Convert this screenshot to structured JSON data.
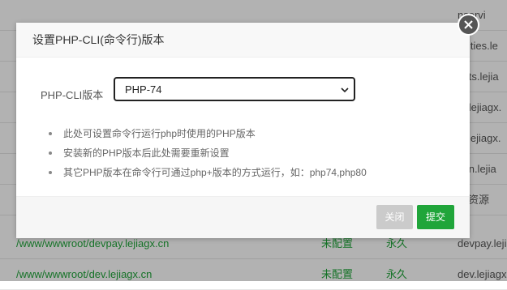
{
  "background_table": {
    "rows": [
      {
        "path": "",
        "status": "",
        "expire": "",
        "remark": "nservi"
      },
      {
        "path": "",
        "status": "",
        "expire": "",
        "remark": "tivities.le"
      },
      {
        "path": "",
        "status": "",
        "expire": "",
        "remark": "sets.lejia"
      },
      {
        "path": "",
        "status": "",
        "expire": "",
        "remark": "st.lejiagx."
      },
      {
        "path": "",
        "status": "",
        "expire": "",
        "remark": "vi.lejiagx."
      },
      {
        "path": "",
        "status": "",
        "expire": "",
        "remark": "min.lejia"
      },
      {
        "path": "",
        "status": "",
        "expire": "",
        "remark": "片资源"
      },
      {
        "path": "/www/wwwroot/devpay.lejiagx.cn",
        "status": "未配置",
        "expire": "永久",
        "remark": "devpay.leji"
      },
      {
        "path": "/www/wwwroot/dev.lejiagx.cn",
        "status": "未配置",
        "expire": "永久",
        "remark": "dev.lejiagx"
      }
    ]
  },
  "dialog": {
    "title": "设置PHP-CLI(命令行)版本",
    "field_label": "PHP-CLI版本",
    "select_value": "PHP-74",
    "tips": [
      "此处可设置命令行运行php时使用的PHP版本",
      "安装新的PHP版本后此处需要重新设置",
      "其它PHP版本在命令行可通过php+版本的方式运行，如：php74,php80"
    ],
    "close_label": "关闭",
    "submit_label": "提交"
  },
  "colors": {
    "accent": "#20a53a",
    "disabled_button": "#cbcbcb",
    "overlay": "rgba(0,0,0,0.3)"
  },
  "icons": {
    "dialog_close": "close-icon",
    "select_arrow": "chevron-down-icon"
  }
}
